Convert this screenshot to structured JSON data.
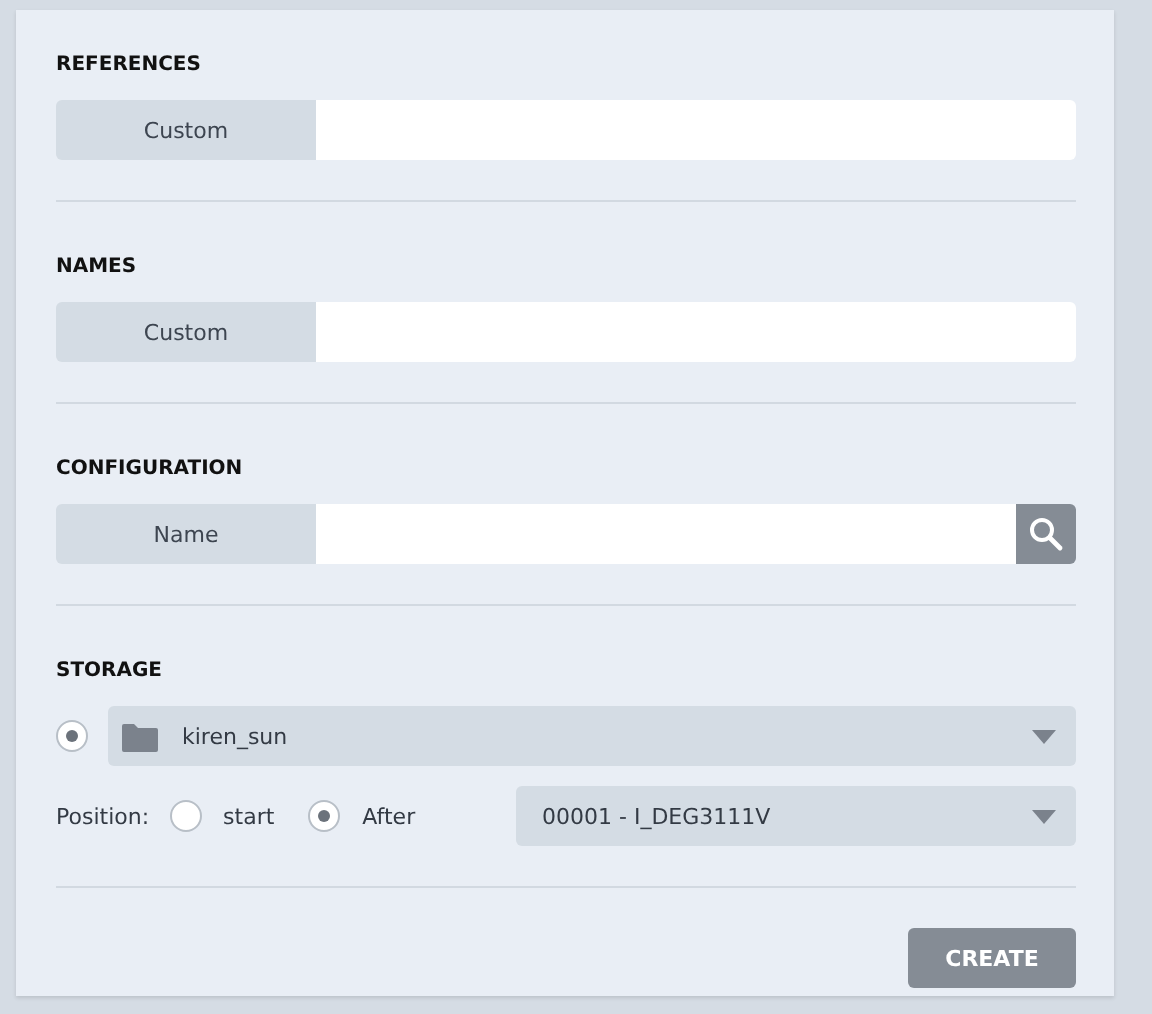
{
  "sections": [
    {
      "kind": "field",
      "title": "REFERENCES",
      "label": "Custom"
    },
    {
      "kind": "field",
      "title": "NAMES",
      "label": "Custom"
    },
    {
      "kind": "search",
      "title": "CONFIGURATION",
      "label": "Name"
    }
  ],
  "storage": {
    "title": "STORAGE",
    "selected": true,
    "folder": "kiren_sun",
    "position_label": "Position:",
    "options": [
      {
        "label": "start",
        "selected": false
      },
      {
        "label": "After",
        "selected": true
      }
    ],
    "after_value": "00001 - I_DEG3111V"
  },
  "button": "CREATE"
}
